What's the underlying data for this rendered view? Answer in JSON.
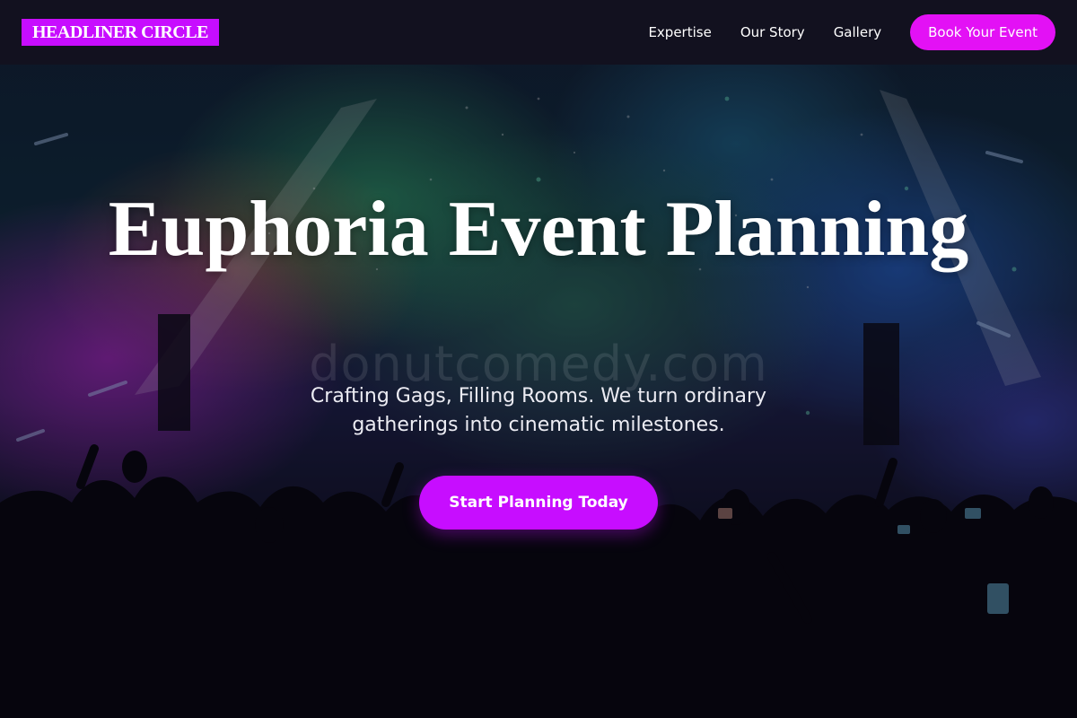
{
  "colors": {
    "brand_bg": "#c70dff",
    "accent": "#e311f5",
    "navbar_bg": "#12111f",
    "text": "#ffffff"
  },
  "navbar": {
    "brand": "HEADLINER CIRCLE",
    "links": [
      {
        "label": "Expertise"
      },
      {
        "label": "Our Story"
      },
      {
        "label": "Gallery"
      }
    ],
    "cta_label": "Book Your Event"
  },
  "hero": {
    "background_image": "concert-crowd-stage-lights",
    "watermark": "donutcomedy.com",
    "title": "Euphoria Event Planning",
    "subtitle": "Crafting Gags, Filling Rooms. We turn ordinary gatherings into cinematic milestones.",
    "cta_label": "Start Planning Today"
  }
}
